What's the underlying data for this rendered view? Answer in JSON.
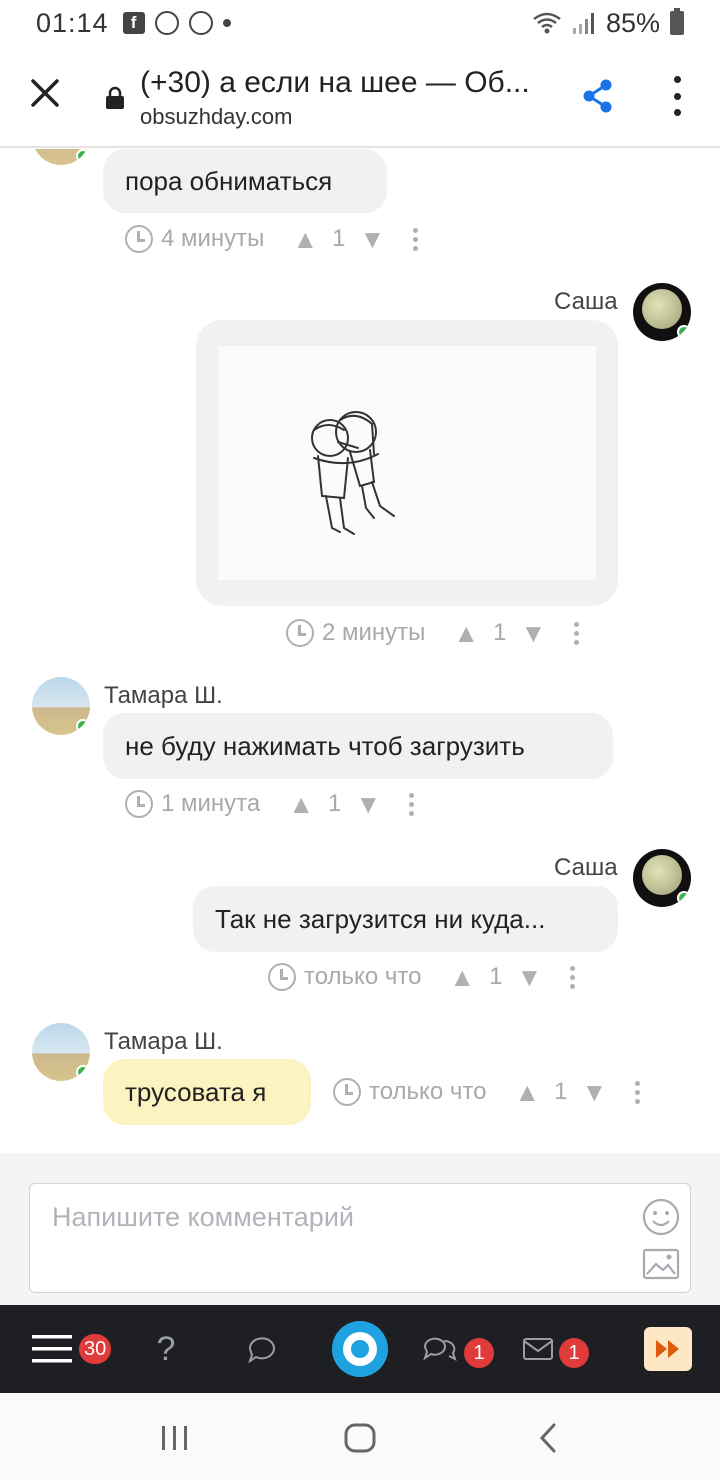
{
  "status_bar": {
    "time": "01:14",
    "battery": "85%",
    "icons": [
      "facebook-icon",
      "notification-icon",
      "whatsapp-icon",
      "dot-icon",
      "wifi-icon",
      "signal-icon",
      "battery-icon"
    ]
  },
  "browser": {
    "title": "(+30) а если на шее — Об...",
    "domain": "obsuzhday.com",
    "icons": [
      "close-icon",
      "lock-icon",
      "share-icon",
      "more-icon"
    ],
    "accent": "#1a73e8"
  },
  "messages": [
    {
      "author": "",
      "text": "пора обниматься",
      "time": "4 минуты",
      "votes": "1"
    },
    {
      "author": "Саша",
      "text": "",
      "time": "2 минуты",
      "votes": "1"
    },
    {
      "author": "Тамара Ш.",
      "text": "не буду нажимать чтоб загрузить",
      "time": "1 минута",
      "votes": "1"
    },
    {
      "author": "Саша",
      "text": "Так не загрузится ни куда...",
      "time": "только что",
      "votes": "1"
    },
    {
      "author": "Тамара Ш.",
      "text": "трусовата я",
      "time": "только что",
      "votes": "1"
    }
  ],
  "composer": {
    "placeholder": "Напишите комментарий"
  },
  "appbar": {
    "menu_badge": "30",
    "chats_badge": "1",
    "mail_badge": "1"
  },
  "colors": {
    "bubble": "#f0f1f3",
    "own_bubble": "#fdf3c0",
    "online": "#3cb34a",
    "badge": "#e03a3a",
    "appbar": "#1e1f22",
    "logo": "#1fa3e0"
  }
}
